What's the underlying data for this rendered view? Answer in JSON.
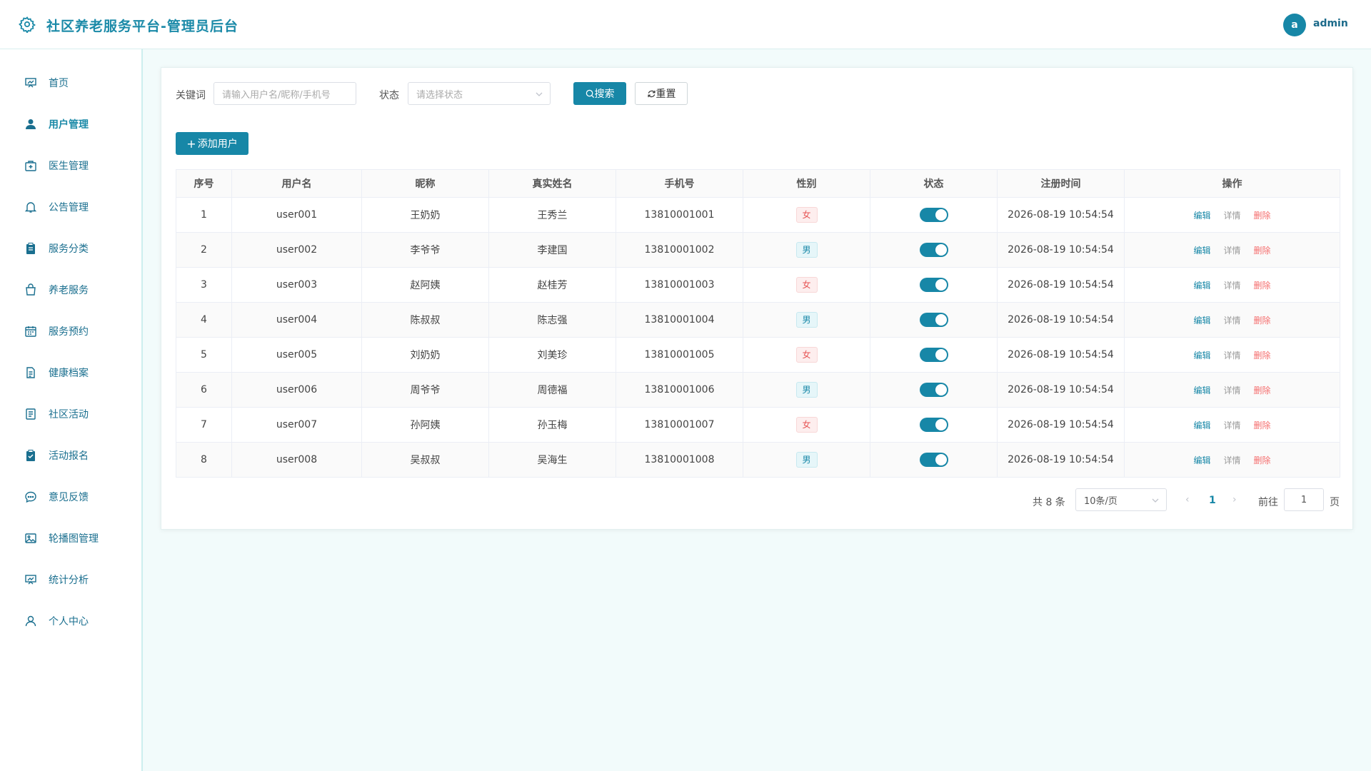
{
  "app": {
    "title": "社区养老服务平台-管理员后台"
  },
  "user": {
    "avatar_letter": "a",
    "name": "admin"
  },
  "sidebar": {
    "items": [
      {
        "label": "首页",
        "icon": "dashboard-icon"
      },
      {
        "label": "用户管理",
        "icon": "user-icon",
        "active": true
      },
      {
        "label": "医生管理",
        "icon": "medical-kit-icon"
      },
      {
        "label": "公告管理",
        "icon": "bell-icon"
      },
      {
        "label": "服务分类",
        "icon": "clipboard-icon"
      },
      {
        "label": "养老服务",
        "icon": "shopping-bag-icon"
      },
      {
        "label": "服务预约",
        "icon": "calendar-icon"
      },
      {
        "label": "健康档案",
        "icon": "document-icon"
      },
      {
        "label": "社区活动",
        "icon": "list-icon"
      },
      {
        "label": "活动报名",
        "icon": "checklist-icon"
      },
      {
        "label": "意见反馈",
        "icon": "chat-icon"
      },
      {
        "label": "轮播图管理",
        "icon": "image-icon"
      },
      {
        "label": "统计分析",
        "icon": "chart-icon"
      },
      {
        "label": "个人中心",
        "icon": "profile-icon"
      }
    ]
  },
  "filter": {
    "keyword_label": "关键词",
    "keyword_placeholder": "请输入用户名/昵称/手机号",
    "status_label": "状态",
    "status_placeholder": "请选择状态",
    "search_label": "搜索",
    "reset_label": "重置"
  },
  "add_button": "添加用户",
  "table": {
    "columns": [
      "序号",
      "用户名",
      "昵称",
      "真实姓名",
      "手机号",
      "性别",
      "状态",
      "注册时间",
      "操作"
    ],
    "actions": {
      "edit": "编辑",
      "detail": "详情",
      "delete": "删除"
    },
    "rows": [
      {
        "no": "1",
        "username": "user001",
        "nickname": "王奶奶",
        "realname": "王秀兰",
        "phone": "13810001001",
        "gender": "女",
        "enabled": true,
        "registered": "2026-08-19 10:54:54"
      },
      {
        "no": "2",
        "username": "user002",
        "nickname": "李爷爷",
        "realname": "李建国",
        "phone": "13810001002",
        "gender": "男",
        "enabled": true,
        "registered": "2026-08-19 10:54:54"
      },
      {
        "no": "3",
        "username": "user003",
        "nickname": "赵阿姨",
        "realname": "赵桂芳",
        "phone": "13810001003",
        "gender": "女",
        "enabled": true,
        "registered": "2026-08-19 10:54:54"
      },
      {
        "no": "4",
        "username": "user004",
        "nickname": "陈叔叔",
        "realname": "陈志强",
        "phone": "13810001004",
        "gender": "男",
        "enabled": true,
        "registered": "2026-08-19 10:54:54"
      },
      {
        "no": "5",
        "username": "user005",
        "nickname": "刘奶奶",
        "realname": "刘美珍",
        "phone": "13810001005",
        "gender": "女",
        "enabled": true,
        "registered": "2026-08-19 10:54:54"
      },
      {
        "no": "6",
        "username": "user006",
        "nickname": "周爷爷",
        "realname": "周德福",
        "phone": "13810001006",
        "gender": "男",
        "enabled": true,
        "registered": "2026-08-19 10:54:54"
      },
      {
        "no": "7",
        "username": "user007",
        "nickname": "孙阿姨",
        "realname": "孙玉梅",
        "phone": "13810001007",
        "gender": "女",
        "enabled": true,
        "registered": "2026-08-19 10:54:54"
      },
      {
        "no": "8",
        "username": "user008",
        "nickname": "吴叔叔",
        "realname": "吴海生",
        "phone": "13810001008",
        "gender": "男",
        "enabled": true,
        "registered": "2026-08-19 10:54:54"
      }
    ]
  },
  "pagination": {
    "total_text": "共 8 条",
    "page_size": "10条/页",
    "current_page": "1",
    "goto_label": "前往",
    "goto_value": "1",
    "page_suffix": "页"
  },
  "colors": {
    "accent": "#1787a7",
    "danger": "#f56c6c",
    "background": "#f2fbfb"
  }
}
